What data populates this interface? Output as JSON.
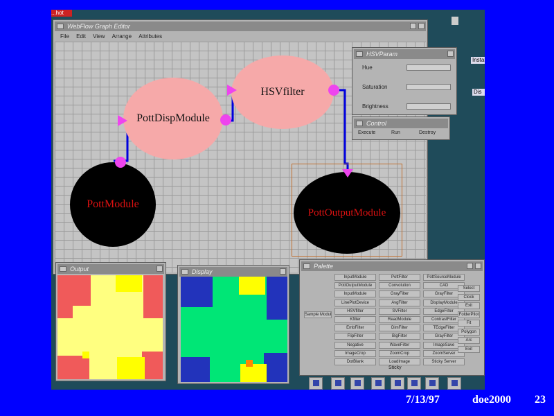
{
  "desktop": {
    "top_label": "...hot",
    "side_labels": [
      "Install",
      "Dis"
    ]
  },
  "graph_editor": {
    "title": "WebFlow Graph Editor",
    "menu": [
      "File",
      "Edit",
      "View",
      "Arrange",
      "Attributes"
    ],
    "nodes": {
      "pott_disp": "PottDispModule",
      "hsv": "HSVfilter",
      "pott_module": "PottModule",
      "pott_output": "PottOutputModule"
    },
    "colors": {
      "node_pink": "#f6a9a9",
      "node_black": "#000000",
      "port": "#ee44ee",
      "edge": "#0000dd",
      "label_red": "#dd1111"
    }
  },
  "hsv_param": {
    "title": "HSVParam",
    "rows": [
      "Hue",
      "Saturation",
      "Brightness"
    ]
  },
  "control": {
    "title": "Control",
    "options": [
      "Execute",
      "Run",
      "Destroy"
    ]
  },
  "output_win": {
    "title": "Output",
    "colors": {
      "red": "#f05a5a",
      "yellow": "#ffff80",
      "bright_yellow": "#ffff00"
    }
  },
  "display_win": {
    "title": "Display",
    "colors": {
      "green": "#00e676",
      "blue": "#2233bb",
      "yellow": "#ffff00",
      "orange": "#ff8800"
    }
  },
  "palette": {
    "title": "Palette",
    "left_button": "Sample Module",
    "columns": [
      [
        "InputModule",
        "PottOutputModule",
        "InputModule",
        "LinePlotDevice",
        "HSVfilter",
        "Kfilter",
        "EmbFilter",
        "FlipFilter",
        "Negative",
        "ImageCrop",
        "DotBlank"
      ],
      [
        "PottFilter",
        "Convolution",
        "GrayFilter",
        "AvgFilter",
        "SVFilter",
        "ReadModule",
        "DimFilter",
        "BigFilter",
        "WaveFilter",
        "ZoomCrop",
        "LoadImage"
      ],
      [
        "PottSourceModule",
        "CAD",
        "GrayFilter",
        "DisplayModule",
        "EdgeFilter",
        "ContrastFilter",
        "TEdgeFilter",
        "GrayFilter",
        "ImageSave",
        "ZoomServer",
        "Sticky Server"
      ]
    ],
    "side_buttons": [
      "Select",
      "Clock",
      "Exit",
      "FolderPilot",
      "Fit",
      "Polygon",
      "Arc",
      "Exit"
    ],
    "bottom_label": "Sticky"
  },
  "taskbar": {
    "icons": [
      "terminal-icon",
      "pen-icon",
      "globe-icon",
      "folder-icon",
      "disk-icon",
      "printer-icon",
      "binoculars-icon",
      "trash-icon"
    ]
  },
  "footer": {
    "date": "7/13/97",
    "project": "doe2000",
    "page": "23"
  }
}
